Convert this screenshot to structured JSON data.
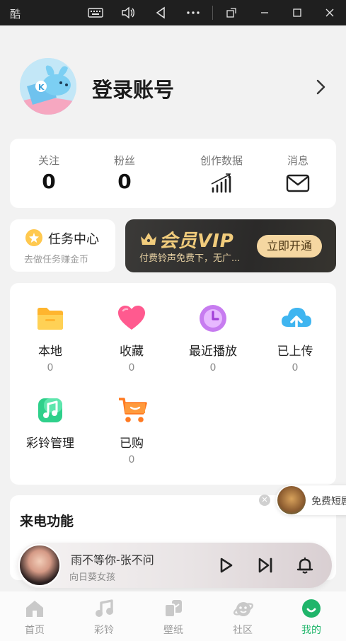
{
  "window": {
    "title": "酷",
    "buttons": [
      "keyboard-icon",
      "volume-icon",
      "back-icon",
      "more-icon",
      "rotate-icon",
      "minimize-icon",
      "maximize-icon",
      "close-icon"
    ]
  },
  "profile": {
    "login_label": "登录账号"
  },
  "stats": [
    {
      "label": "关注",
      "value": "0"
    },
    {
      "label": "粉丝",
      "value": "0"
    },
    {
      "label": "创作数据",
      "icon": "bar-chart-icon"
    },
    {
      "label": "消息",
      "icon": "mail-icon"
    }
  ],
  "task": {
    "title": "任务中心",
    "subtitle": "去做任务赚金币"
  },
  "vip": {
    "title": "会员VIP",
    "subtitle": "付费铃声免费下，无广...",
    "button": "立即开通",
    "colors": {
      "gold": "#f1cc7c",
      "button_bg": "#f5d7a1"
    }
  },
  "grid": [
    {
      "label": "本地",
      "count": "0",
      "icon": "folder-icon"
    },
    {
      "label": "收藏",
      "count": "0",
      "icon": "heart-icon"
    },
    {
      "label": "最近播放",
      "count": "0",
      "icon": "clock-icon"
    },
    {
      "label": "已上传",
      "count": "0",
      "icon": "cloud-upload-icon"
    },
    {
      "label": "彩铃管理",
      "count": "",
      "icon": "music-note-icon"
    },
    {
      "label": "已购",
      "count": "0",
      "icon": "cart-icon"
    }
  ],
  "call": {
    "title": "来电功能"
  },
  "promo": {
    "text": "免费短剧"
  },
  "player": {
    "title": "雨不等你-张不问",
    "artist": "向日葵女孩"
  },
  "nav": [
    {
      "label": "首页",
      "icon": "home-icon",
      "active": false
    },
    {
      "label": "彩铃",
      "icon": "music-icon",
      "active": false
    },
    {
      "label": "壁纸",
      "icon": "wallpaper-icon",
      "active": false
    },
    {
      "label": "社区",
      "icon": "planet-icon",
      "active": false
    },
    {
      "label": "我的",
      "icon": "profile-icon",
      "active": true
    }
  ],
  "theme": {
    "accent": "#1fb56a",
    "background": "#f2f2f2"
  }
}
